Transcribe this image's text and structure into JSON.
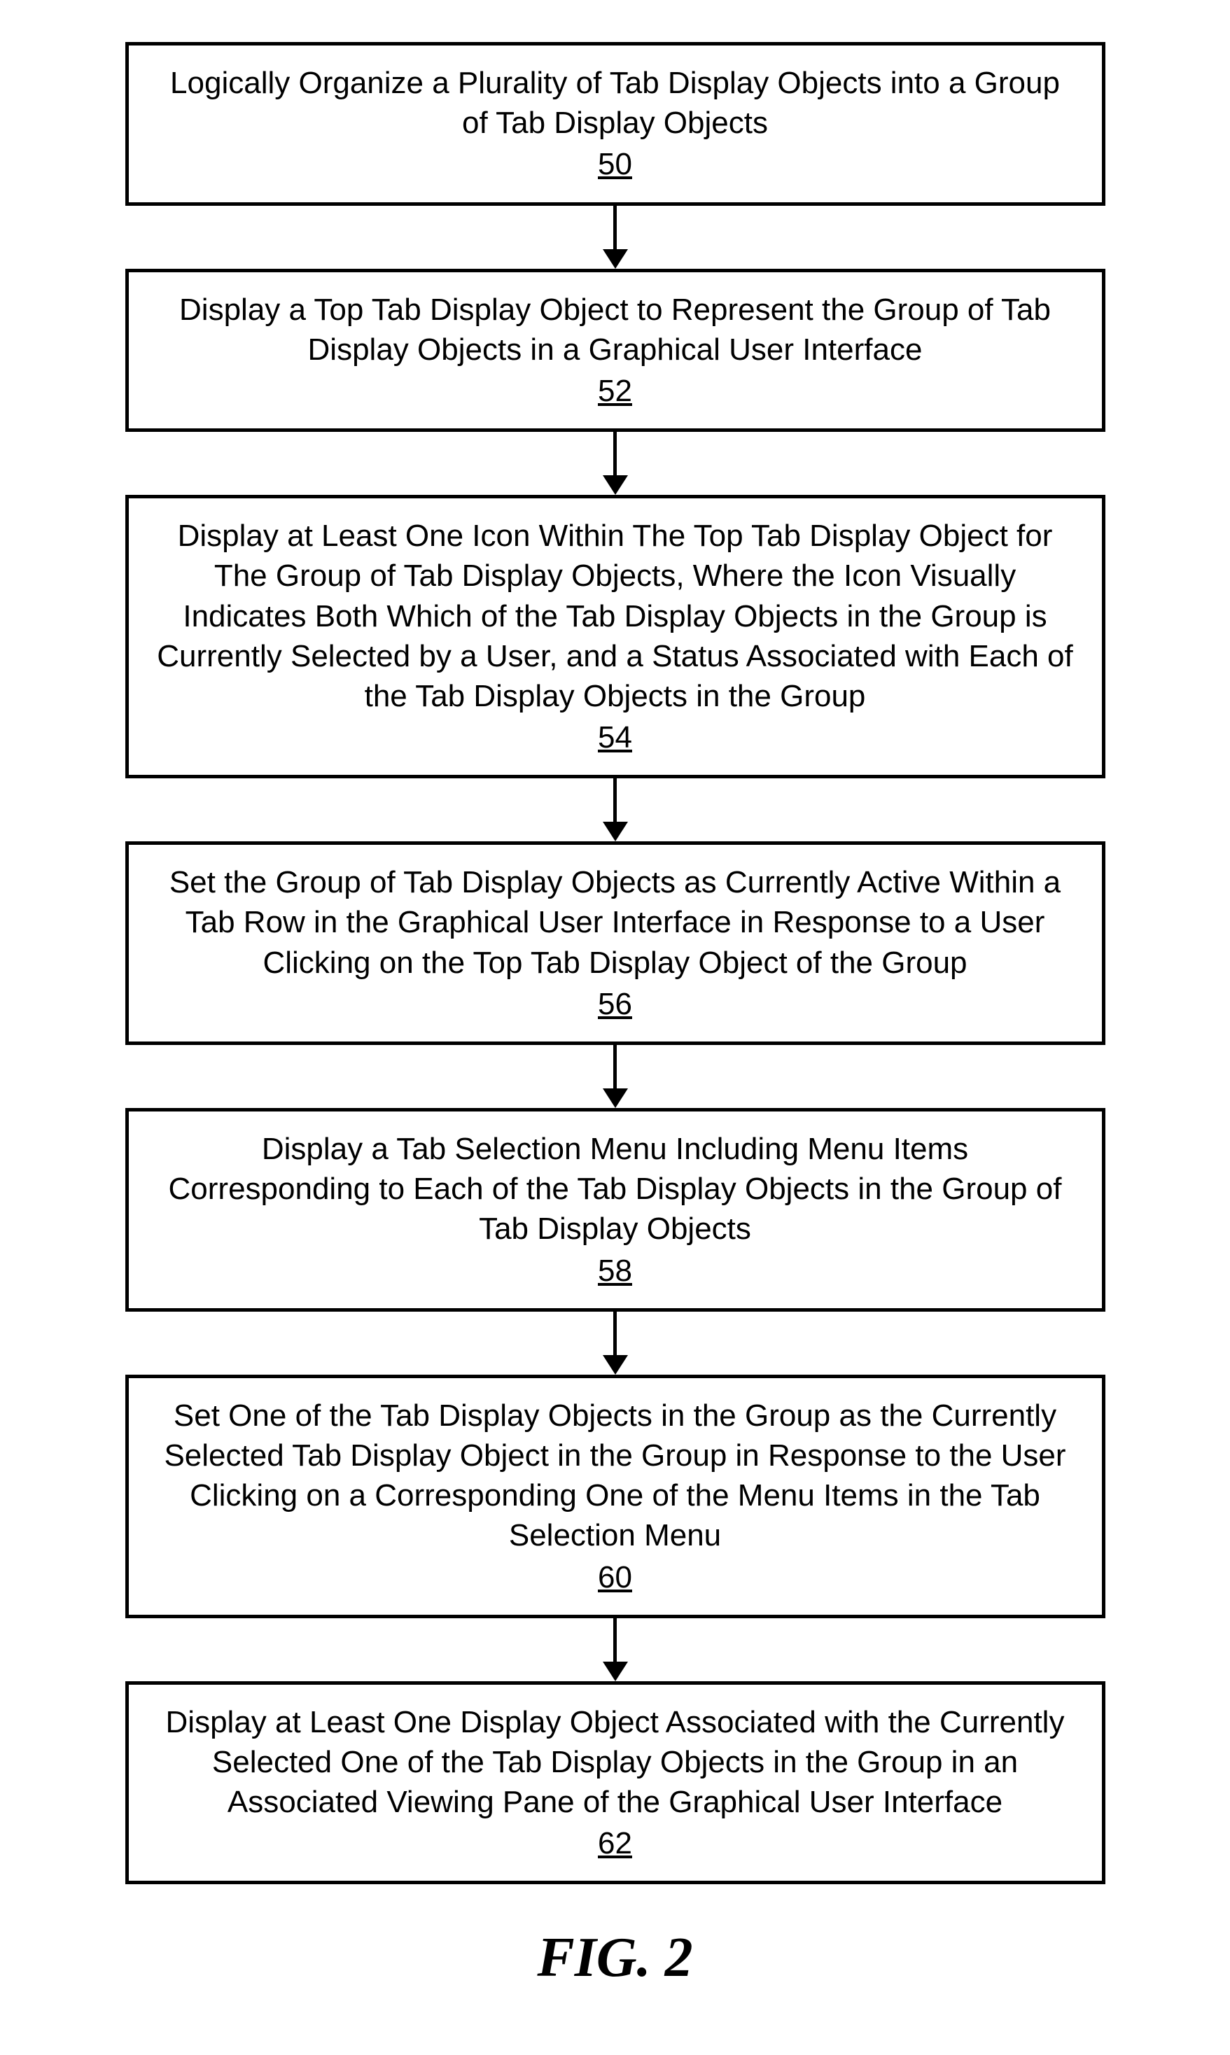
{
  "steps": [
    {
      "text": "Logically Organize a Plurality of Tab Display Objects into a Group of Tab Display Objects",
      "ref": "50"
    },
    {
      "text": "Display a Top Tab Display Object to Represent the Group of Tab Display Objects in a Graphical User Interface",
      "ref": "52"
    },
    {
      "text": "Display at Least One Icon Within The Top Tab Display Object for The Group of Tab Display Objects, Where the Icon Visually Indicates Both Which of the Tab Display Objects in the Group is Currently Selected by a User, and a Status Associated with Each of the Tab Display Objects in the Group",
      "ref": "54"
    },
    {
      "text": "Set the Group of Tab Display Objects as Currently Active Within a Tab Row in the Graphical User Interface in Response to a User Clicking on the Top Tab Display Object of the Group",
      "ref": "56"
    },
    {
      "text": "Display a Tab Selection Menu Including Menu Items Corresponding to Each of the Tab Display Objects in the Group of Tab Display Objects",
      "ref": "58"
    },
    {
      "text": "Set One of the Tab Display Objects in the Group as the Currently Selected Tab Display Object in the Group in Response to the User Clicking on a Corresponding One of the Menu Items in the Tab Selection Menu",
      "ref": "60"
    },
    {
      "text": "Display at Least One Display Object Associated with the Currently Selected One of the Tab Display Objects in the Group in an Associated Viewing Pane of the Graphical User Interface",
      "ref": "62"
    }
  ],
  "figure_label": "FIG. 2"
}
